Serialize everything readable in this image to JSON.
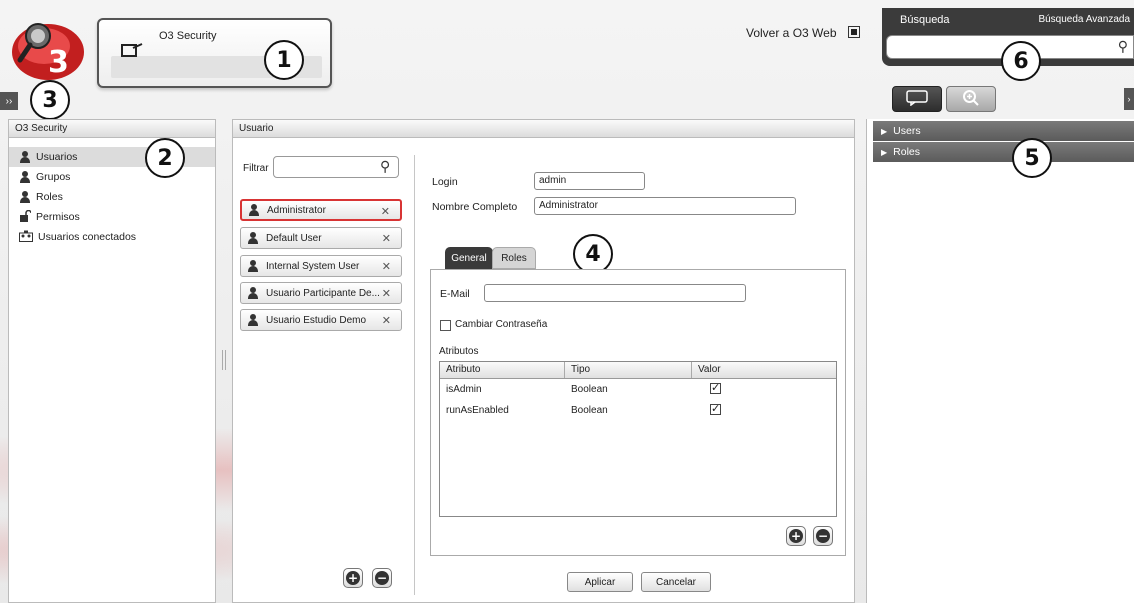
{
  "header": {
    "app_title": "O3 Security",
    "back_link": "Volver a O3 Web"
  },
  "search": {
    "label": "Búsqueda",
    "advanced": "Búsqueda Avanzada",
    "value": ""
  },
  "badges": {
    "b1": "1",
    "b2": "2",
    "b3": "3",
    "b4": "4",
    "b5": "5",
    "b6": "6"
  },
  "left_panel": {
    "title": "O3 Security",
    "items": [
      {
        "label": "Usuarios",
        "icon": "user-icon"
      },
      {
        "label": "Grupos",
        "icon": "group-icon"
      },
      {
        "label": "Roles",
        "icon": "roles-icon"
      },
      {
        "label": "Permisos",
        "icon": "lock-icon"
      },
      {
        "label": "Usuarios conectados",
        "icon": "connected-users-icon"
      }
    ]
  },
  "center_panel": {
    "title": "Usuario",
    "filter_label": "Filtrar",
    "filter_value": "",
    "users": [
      "Administrator",
      "Default User",
      "Internal System User",
      "Usuario Participante De...",
      "Usuario Estudio Demo"
    ],
    "form": {
      "login_label": "Login",
      "login_value": "admin",
      "fullname_label": "Nombre Completo",
      "fullname_value": "Administrator",
      "tabs": [
        "General",
        "Roles"
      ],
      "email_label": "E-Mail",
      "email_value": "",
      "change_password_label": "Cambiar Contraseña",
      "attributes_label": "Atributos",
      "attr_columns": [
        "Atributo",
        "Tipo",
        "Valor"
      ],
      "attr_rows": [
        {
          "atributo": "isAdmin",
          "tipo": "Boolean",
          "valor": true
        },
        {
          "atributo": "runAsEnabled",
          "tipo": "Boolean",
          "valor": true
        }
      ],
      "apply_label": "Aplicar",
      "cancel_label": "Cancelar"
    }
  },
  "right_panel": {
    "items": [
      "Users",
      "Roles"
    ]
  },
  "colors": {
    "accent_red": "#d83434",
    "dark": "#3a3a3a"
  }
}
